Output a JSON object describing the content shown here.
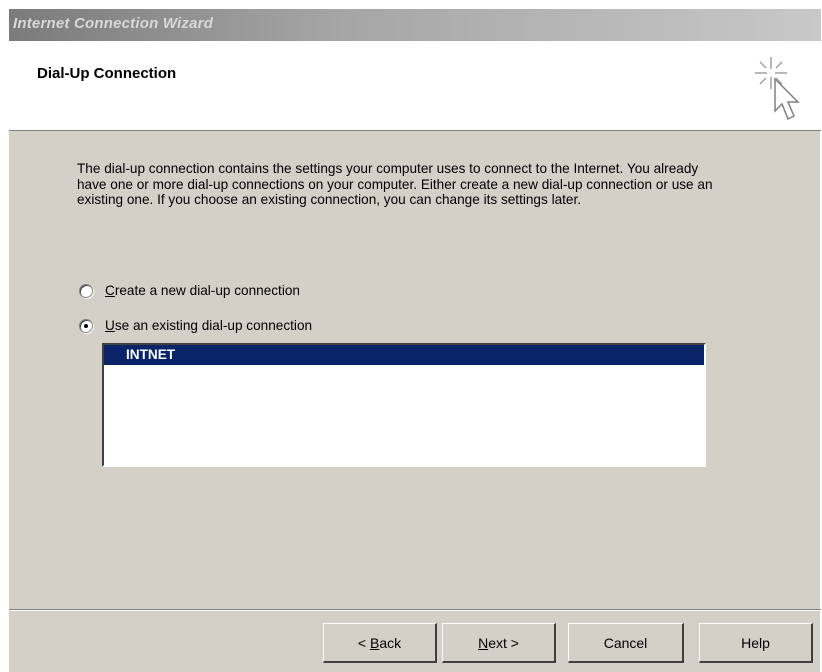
{
  "window": {
    "title": "Internet Connection Wizard"
  },
  "header": {
    "title": "Dial-Up Connection",
    "icon": "wizard-sparkle-cursor-icon"
  },
  "body": {
    "description": "The dial-up connection contains the settings your computer uses to connect to the Internet. You already have one or more dial-up connections on your computer. Either create a new dial-up connection or use an existing one. If you choose an existing connection, you can change its settings later.",
    "options": [
      {
        "label": "Create a new dial-up connection",
        "mnemonic": "C",
        "checked": false
      },
      {
        "label": "Use an existing dial-up connection",
        "mnemonic": "U",
        "checked": true
      }
    ],
    "connections": [
      {
        "name": "INTNET",
        "selected": true
      }
    ]
  },
  "buttons": {
    "back": {
      "prefix": "< ",
      "mnemonic": "B",
      "rest": "ack"
    },
    "next": {
      "mnemonic": "N",
      "rest": "ext >"
    },
    "cancel": "Cancel",
    "help": "Help"
  },
  "colors": {
    "dialog_bg": "#d4d0c8",
    "selection": "#0a246a"
  }
}
